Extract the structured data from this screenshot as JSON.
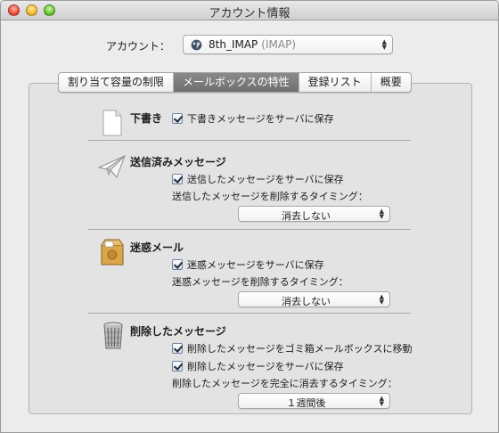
{
  "window": {
    "title": "アカウント情報"
  },
  "account": {
    "label": "アカウント：",
    "name": "8th_IMAP",
    "type": "(IMAP)"
  },
  "tabs": [
    {
      "label": "割り当て容量の制限",
      "active": false
    },
    {
      "label": "メールボックスの特性",
      "active": true
    },
    {
      "label": "登録リスト",
      "active": false
    },
    {
      "label": "概要",
      "active": false
    }
  ],
  "drafts": {
    "title": "下書き",
    "checkbox": "下書きメッセージをサーバに保存",
    "checked": true
  },
  "sent": {
    "title": "送信済みメッセージ",
    "checkbox": "送信したメッセージをサーバに保存",
    "checked": true,
    "delete_label": "送信したメッセージを削除するタイミング：",
    "delete_value": "消去しない"
  },
  "junk": {
    "title": "迷惑メール",
    "checkbox": "迷惑メッセージをサーバに保存",
    "checked": true,
    "delete_label": "迷惑メッセージを削除するタイミング：",
    "delete_value": "消去しない"
  },
  "trash": {
    "title": "削除したメッセージ",
    "checkbox_move": "削除したメッセージをゴミ箱メールボックスに移動",
    "checkbox_store": "削除したメッセージをサーバに保存",
    "checked_move": true,
    "checked_store": true,
    "delete_label": "削除したメッセージを完全に消去するタイミング：",
    "delete_value": "１週間後"
  },
  "icons": {
    "drafts": "document-icon",
    "sent": "paper-plane-icon",
    "junk": "junk-bag-icon",
    "trash": "trash-can-icon",
    "account": "globe-icon"
  }
}
